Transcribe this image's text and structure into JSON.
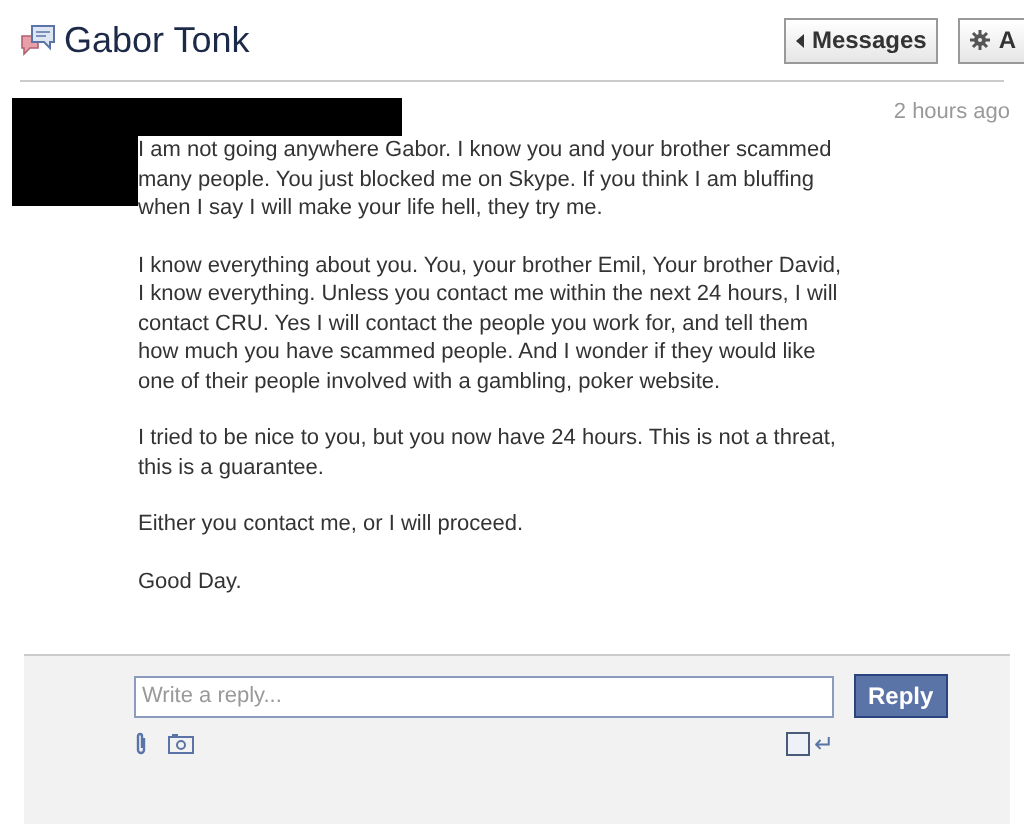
{
  "header": {
    "title": "Gabor Tonk",
    "buttons": [
      {
        "label": "Messages",
        "kind": "back"
      },
      {
        "label": "A",
        "kind": "actions"
      }
    ]
  },
  "message": {
    "time": "2 hours ago",
    "paragraphs": [
      "I am not going anywhere Gabor. I know you and your brother scammed many people. You just blocked me on Skype. If you think I am bluffing when I say I will make your life hell, they try me.",
      "I know everything about you. You, your brother Emil, Your brother David, I know everything. Unless you contact me within the next 24 hours, I will contact CRU. Yes I will contact the people you work for, and tell them how much you have scammed people. And I wonder if they would like one of their people involved with a gambling, poker website.",
      "I tried to be nice to you, but you now have 24 hours. This is not a threat, this is a guarantee.",
      "Either you contact me, or I will proceed.",
      "Good Day."
    ]
  },
  "reply": {
    "placeholder": "Write a reply...",
    "button": "Reply",
    "enter_to_send": {
      "checked": false,
      "symbol": "↵"
    }
  }
}
